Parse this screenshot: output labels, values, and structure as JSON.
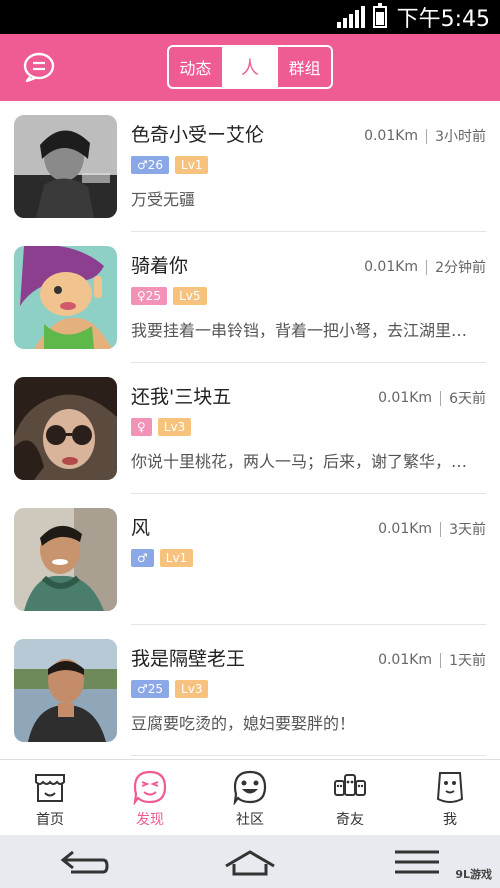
{
  "status_bar": {
    "time": "下午5:45"
  },
  "header": {
    "segments": [
      "动态",
      "人",
      "群组"
    ],
    "active_segment": 1
  },
  "people": [
    {
      "name": "色奇小受ー艾伦",
      "gender": "♂",
      "age": "26",
      "level": "Lv1",
      "distance": "0.01Km",
      "time": "3小时前",
      "signature": "万受无疆"
    },
    {
      "name": "骑着你",
      "gender": "♀",
      "age": "25",
      "level": "Lv5",
      "distance": "0.01Km",
      "time": "2分钟前",
      "signature": "我要挂着一串铃铛，背着一把小弩，去江湖里…"
    },
    {
      "name": "还我'三块五",
      "gender": "♀",
      "age": "",
      "level": "Lv3",
      "distance": "0.01Km",
      "time": "6天前",
      "signature": "你说十里桃花，两人一马；后来，谢了繁华，…"
    },
    {
      "name": "风",
      "gender": "♂",
      "age": "",
      "level": "Lv1",
      "distance": "0.01Km",
      "time": "3天前",
      "signature": ""
    },
    {
      "name": "我是隔壁老王",
      "gender": "♂",
      "age": "25",
      "level": "Lv3",
      "distance": "0.01Km",
      "time": "1天前",
      "signature": "豆腐要吃烫的，媳妇要娶胖的！"
    }
  ],
  "tabs": [
    {
      "label": "首页",
      "icon": "shop-icon"
    },
    {
      "label": "发现",
      "icon": "discover-face-icon",
      "active": true
    },
    {
      "label": "社区",
      "icon": "community-face-icon"
    },
    {
      "label": "奇友",
      "icon": "friends-icon"
    },
    {
      "label": "我",
      "icon": "me-face-icon"
    }
  ],
  "watermark": "9L游戏",
  "colors": {
    "brand": "#ef5b93",
    "male": "#8aa7e6",
    "female": "#f192b6",
    "level": "#f7c27e"
  }
}
